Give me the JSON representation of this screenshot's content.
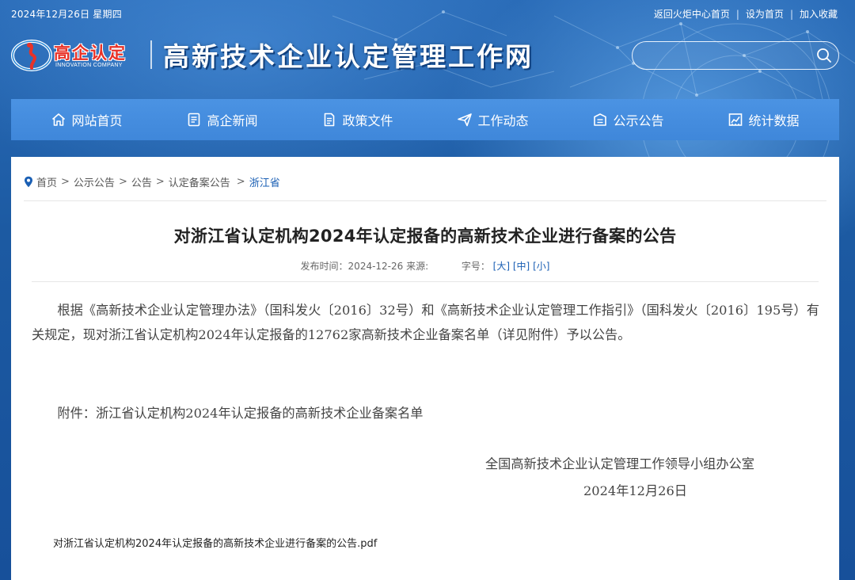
{
  "topbar": {
    "date": "2024年12月26日 星期四",
    "links": [
      "返回火炬中心首页",
      "设为首页",
      "加入收藏"
    ]
  },
  "logo": {
    "cn_text": "高企认定",
    "en_text": "INNOVATION COMPANY",
    "site_title": "高新技术企业认定管理工作网"
  },
  "search": {
    "placeholder": ""
  },
  "nav": [
    {
      "label": "网站首页",
      "icon": "home-icon"
    },
    {
      "label": "高企新闻",
      "icon": "news-icon"
    },
    {
      "label": "政策文件",
      "icon": "document-icon"
    },
    {
      "label": "工作动态",
      "icon": "send-icon"
    },
    {
      "label": "公示公告",
      "icon": "notice-icon"
    },
    {
      "label": "统计数据",
      "icon": "chart-icon"
    }
  ],
  "breadcrumb": [
    "首页",
    "公示公告",
    "公告",
    "认定备案公告",
    "浙江省"
  ],
  "article": {
    "title": "对浙江省认定机构2024年认定报备的高新技术企业进行备案的公告",
    "publish_label": "发布时间：2024-12-26 来源:",
    "font_label": "字号：",
    "font_large": "[大]",
    "font_medium": "[中]",
    "font_small": "[小]",
    "paragraph": "根据《高新技术企业认定管理办法》（国科发火〔2016〕32号）和《高新技术企业认定管理工作指引》（国科发火〔2016〕195号）有关规定，现对浙江省认定机构2024年认定报备的12762家高新技术企业备案名单（详见附件）予以公告。",
    "attachment_note": "附件：浙江省认定机构2024年认定报备的高新技术企业备案名单",
    "sign_org": "全国高新技术企业认定管理工作领导小组办公室",
    "sign_date": "2024年12月26日",
    "file_link": "对浙江省认定机构2024年认定报备的高新技术企业进行备案的公告.pdf"
  },
  "colors": {
    "header_blue": "#1d5ea8",
    "nav_blue": "#4b93e3",
    "logo_red": "#e83228",
    "link_blue": "#1a5fb4"
  }
}
